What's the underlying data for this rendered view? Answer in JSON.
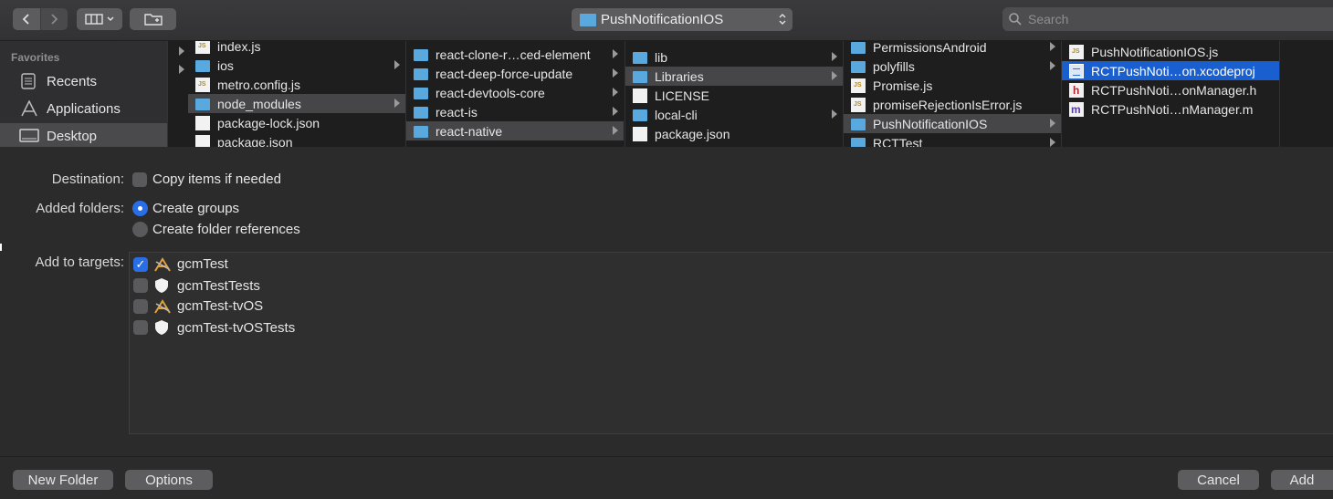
{
  "toolbar": {
    "back_icon": "chevron-left-icon",
    "forward_icon": "chevron-right-icon",
    "view_icon": "column-view-icon",
    "new_folder_icon": "new-folder-icon",
    "path_title": "PushNotificationIOS",
    "search_placeholder": "Search"
  },
  "sidebar": {
    "heading": "Favorites",
    "items": [
      {
        "label": "Recents",
        "icon": "recents-icon"
      },
      {
        "label": "Applications",
        "icon": "applications-icon"
      },
      {
        "label": "Desktop",
        "icon": "desktop-icon"
      }
    ]
  },
  "columns": [
    {
      "items": [
        {
          "label": "index.js",
          "kind": "js",
          "arrow": false
        },
        {
          "label": "ios",
          "kind": "folder",
          "arrow": true
        },
        {
          "label": "metro.config.js",
          "kind": "js",
          "arrow": false
        },
        {
          "label": "node_modules",
          "kind": "folder",
          "arrow": true,
          "state": "selected"
        },
        {
          "label": "package-lock.json",
          "kind": "doc",
          "arrow": false
        },
        {
          "label": "package.json",
          "kind": "doc",
          "arrow": false
        }
      ]
    },
    {
      "items": [
        {
          "label": "react-clone-r…ced-element",
          "kind": "folder",
          "arrow": true
        },
        {
          "label": "react-deep-force-update",
          "kind": "folder",
          "arrow": true
        },
        {
          "label": "react-devtools-core",
          "kind": "folder",
          "arrow": true
        },
        {
          "label": "react-is",
          "kind": "folder",
          "arrow": true
        },
        {
          "label": "react-native",
          "kind": "folder",
          "arrow": true,
          "state": "selected"
        }
      ]
    },
    {
      "items": [
        {
          "label": "lib",
          "kind": "folder",
          "arrow": true
        },
        {
          "label": "Libraries",
          "kind": "folder",
          "arrow": true,
          "state": "selected"
        },
        {
          "label": "LICENSE",
          "kind": "doc",
          "arrow": false
        },
        {
          "label": "local-cli",
          "kind": "folder",
          "arrow": true
        },
        {
          "label": "package.json",
          "kind": "doc",
          "arrow": false
        }
      ]
    },
    {
      "items": [
        {
          "label": "PermissionsAndroid",
          "kind": "folder",
          "arrow": true
        },
        {
          "label": "polyfills",
          "kind": "folder",
          "arrow": true
        },
        {
          "label": "Promise.js",
          "kind": "js",
          "arrow": false
        },
        {
          "label": "promiseRejectionIsError.js",
          "kind": "js",
          "arrow": false
        },
        {
          "label": "PushNotificationIOS",
          "kind": "folder",
          "arrow": true,
          "state": "selected"
        },
        {
          "label": "RCTTest",
          "kind": "folder",
          "arrow": true
        }
      ]
    },
    {
      "items": [
        {
          "label": "PushNotificationIOS.js",
          "kind": "js",
          "arrow": false
        },
        {
          "label": "RCTPushNoti…on.xcodeproj",
          "kind": "xcodeproj",
          "arrow": false,
          "state": "highlighted"
        },
        {
          "label": "RCTPushNoti…onManager.h",
          "kind": "h",
          "arrow": false
        },
        {
          "label": "RCTPushNoti…nManager.m",
          "kind": "m",
          "arrow": false
        }
      ]
    }
  ],
  "options": {
    "destination_label": "Destination:",
    "copy_items_label": "Copy items if needed",
    "copy_items_checked": false,
    "added_folders_label": "Added folders:",
    "create_groups_label": "Create groups",
    "create_groups_selected": true,
    "folder_refs_label": "Create folder references",
    "folder_refs_selected": false,
    "targets_label": "Add to targets:",
    "targets": [
      {
        "label": "gcmTest",
        "checked": true,
        "icon": "app-target-icon"
      },
      {
        "label": "gcmTestTests",
        "checked": false,
        "icon": "test-target-icon"
      },
      {
        "label": "gcmTest-tvOS",
        "checked": false,
        "icon": "app-target-icon"
      },
      {
        "label": "gcmTest-tvOSTests",
        "checked": false,
        "icon": "test-target-icon"
      }
    ]
  },
  "footer": {
    "new_folder_label": "New Folder",
    "options_label": "Options",
    "cancel_label": "Cancel",
    "add_label": "Add"
  },
  "colors": {
    "accent": "#2a6ee6",
    "selection_highlight": "#1a5fd0",
    "folder": "#5aa9de"
  }
}
